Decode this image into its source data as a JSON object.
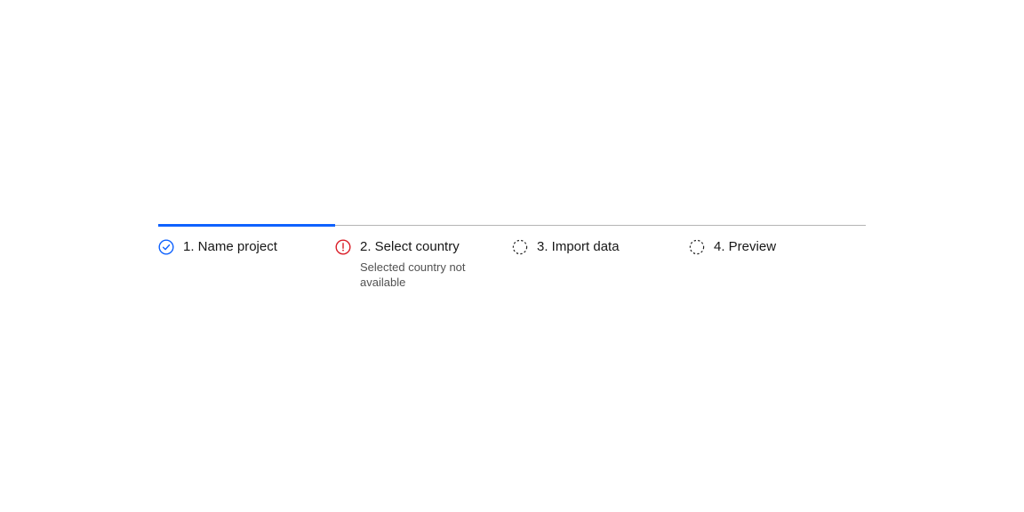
{
  "colors": {
    "accent": "#0f62fe",
    "error": "#da1e28",
    "track": "#b5b5b5",
    "text": "#171717",
    "subtext": "#525252"
  },
  "progress": {
    "completed_steps": 1,
    "total_steps": 4,
    "fill_fraction": 0.25
  },
  "steps": [
    {
      "label": "1. Name project",
      "sub": "",
      "state": "complete"
    },
    {
      "label": "2. Select country",
      "sub": "Selected country not available",
      "state": "error"
    },
    {
      "label": "3. Import data",
      "sub": "",
      "state": "incomplete"
    },
    {
      "label": "4. Preview",
      "sub": "",
      "state": "incomplete"
    }
  ]
}
